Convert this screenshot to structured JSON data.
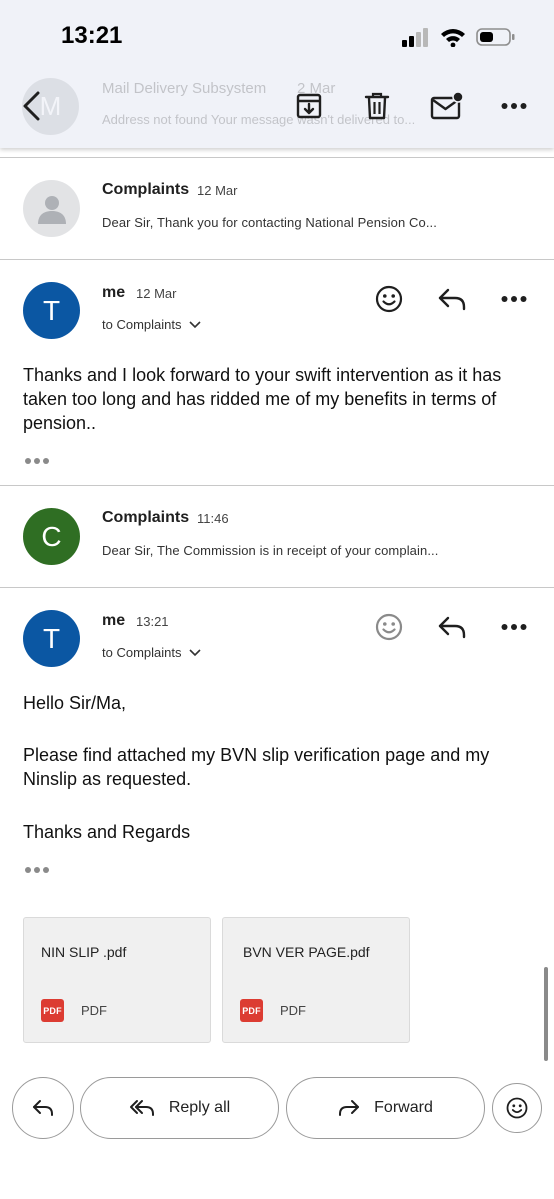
{
  "status_bar": {
    "time": "13:21"
  },
  "previous_message": {
    "avatar_letter": "M",
    "sender": "Mail Delivery Subsystem",
    "date": "2 Mar",
    "snippet": "Address not found Your message wasn't delivered to..."
  },
  "messages": [
    {
      "sender": "Complaints",
      "date": "12 Mar",
      "snippet": "Dear Sir, Thank you for contacting National Pension Co...",
      "avatar": "person"
    },
    {
      "sender": "me",
      "date": "12 Mar",
      "avatar_letter": "T",
      "to": "to Complaints",
      "body": "Thanks and I look forward to your swift intervention as it has taken too long and has ridded me of my benefits in terms of pension.."
    },
    {
      "sender": "Complaints",
      "date": "11:46",
      "avatar_letter": "C",
      "snippet": "Dear Sir, The Commission is in receipt of your complain..."
    },
    {
      "sender": "me",
      "date": "13:21",
      "avatar_letter": "T",
      "to": "to Complaints",
      "body_lines": [
        "Hello Sir/Ma,",
        "Please find attached my BVN slip verification page and my Ninslip as requested.",
        "Thanks and Regards"
      ]
    }
  ],
  "attachments": [
    {
      "name": "NIN SLIP .pdf",
      "icon_label": "PDF",
      "type": "PDF"
    },
    {
      "name": "BVN VER PAGE.pdf",
      "icon_label": "PDF",
      "type": "PDF"
    }
  ],
  "actions": {
    "reply_all": "Reply all",
    "forward": "Forward"
  },
  "icons": {
    "toolbar": [
      "back-icon",
      "archive-icon",
      "trash-icon",
      "mark-unread-icon",
      "more-icon"
    ],
    "message": [
      "emoji-icon",
      "reply-icon",
      "more-icon",
      "chevron-down-icon"
    ],
    "bottom": [
      "reply-icon",
      "reply-all-icon",
      "forward-icon",
      "emoji-icon"
    ]
  },
  "colors": {
    "avatar_t": "#0b57a3",
    "avatar_c": "#2f6e23",
    "avatar_person_bg": "#e2e3e5",
    "pdf_red": "#dc3c32",
    "topbar_bg": "#f0f2f8"
  }
}
